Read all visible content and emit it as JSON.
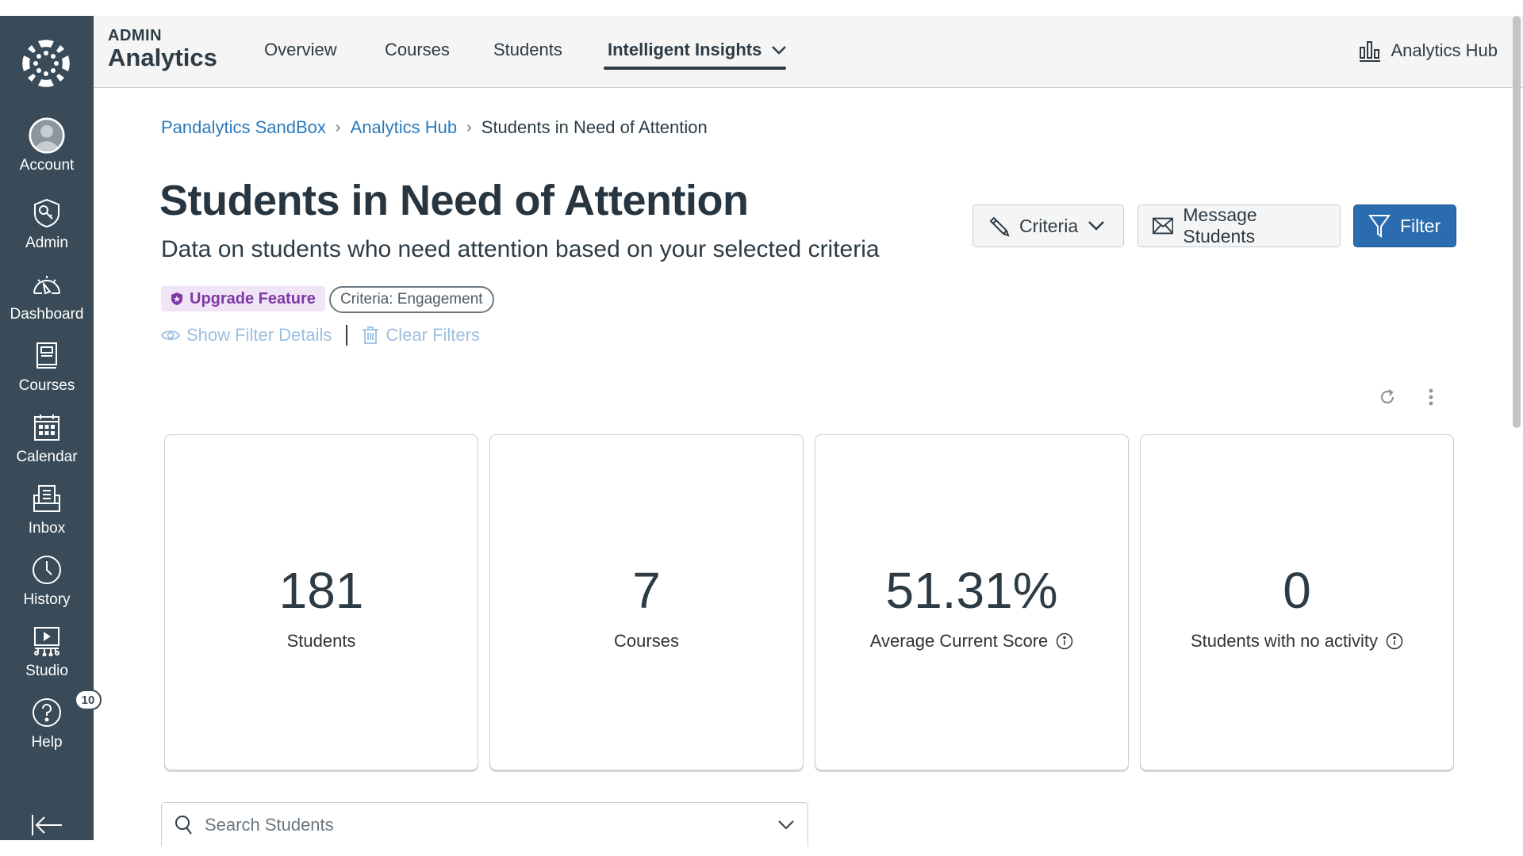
{
  "sidebar": {
    "items": [
      {
        "label": "Account",
        "icon": "avatar-icon"
      },
      {
        "label": "Admin",
        "icon": "admin-shield-icon"
      },
      {
        "label": "Dashboard",
        "icon": "dashboard-gauge-icon"
      },
      {
        "label": "Courses",
        "icon": "book-icon"
      },
      {
        "label": "Calendar",
        "icon": "calendar-icon"
      },
      {
        "label": "Inbox",
        "icon": "inbox-icon"
      },
      {
        "label": "History",
        "icon": "clock-icon"
      },
      {
        "label": "Studio",
        "icon": "studio-icon"
      },
      {
        "label": "Help",
        "icon": "help-icon",
        "badge": "10"
      }
    ],
    "collapse_icon": "collapse-arrow-icon"
  },
  "header": {
    "brand_top": "ADMIN",
    "brand_main": "Analytics",
    "tabs": [
      {
        "label": "Overview",
        "active": false
      },
      {
        "label": "Courses",
        "active": false
      },
      {
        "label": "Students",
        "active": false
      },
      {
        "label": "Intelligent Insights",
        "active": true,
        "has_dropdown": true
      }
    ],
    "hub_link": "Analytics Hub"
  },
  "breadcrumb": [
    {
      "label": "Pandalytics SandBox",
      "link": true
    },
    {
      "label": "Analytics Hub",
      "link": true
    },
    {
      "label": "Students in Need of Attention",
      "link": false
    }
  ],
  "page": {
    "title": "Students in Need of Attention",
    "subtitle": "Data on students who need attention based on your selected criteria"
  },
  "actions": {
    "criteria": "Criteria",
    "message": "Message Students",
    "filter": "Filter"
  },
  "pills": {
    "upgrade": "Upgrade Feature",
    "criteria": "Criteria: Engagement"
  },
  "filter_links": {
    "show": "Show Filter Details",
    "clear": "Clear Filters"
  },
  "cards": [
    {
      "value": "181",
      "label": "Students",
      "info": false
    },
    {
      "value": "7",
      "label": "Courses",
      "info": false
    },
    {
      "value": "51.31%",
      "label": "Average Current Score",
      "info": true
    },
    {
      "value": "0",
      "label": "Students with no activity",
      "info": true
    }
  ],
  "search": {
    "placeholder": "Search Students",
    "value": ""
  },
  "colors": {
    "sidebar_bg": "#394b58",
    "link": "#2b7abc",
    "primary": "#2b6cb0",
    "upgrade_bg": "#f1e4f7",
    "upgrade_fg": "#7e3aa2"
  }
}
